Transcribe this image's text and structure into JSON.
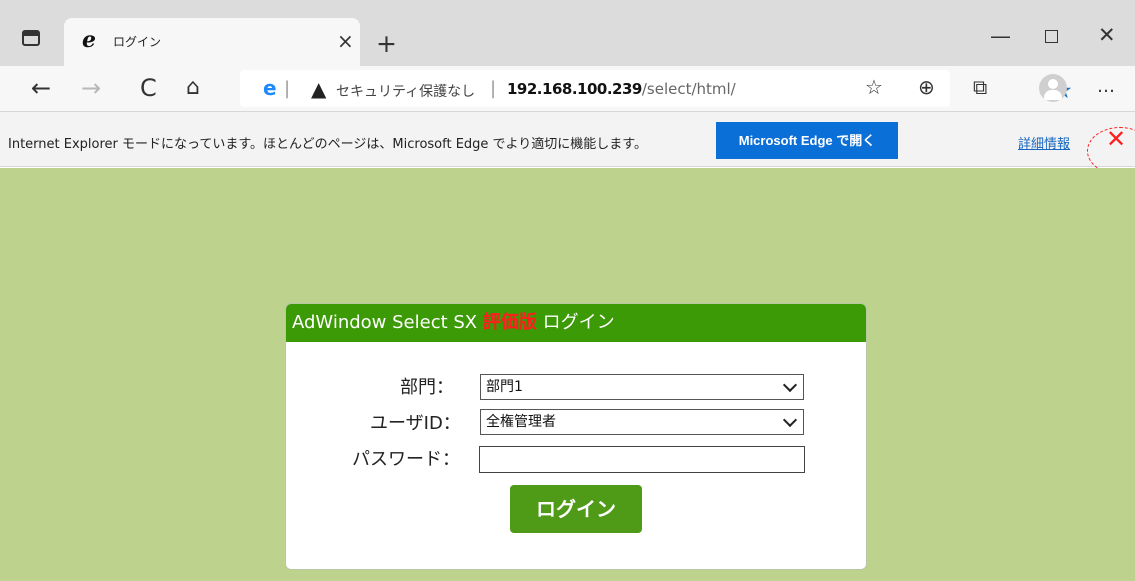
{
  "browser": {
    "tab_title": "ログイン",
    "new_tab": "+",
    "window": {
      "minimize": "—",
      "maximize": "□",
      "close": "✕"
    },
    "nav": {
      "back": "←",
      "forward": "→",
      "refresh": "C",
      "home": "⌂"
    },
    "address": {
      "security": "セキュリティ保護なし",
      "host": "192.168.100.239",
      "path": "/select/html/"
    },
    "toolbar_icons": [
      "star-icon",
      "favorites-icon",
      "collections-icon",
      "extension-icon",
      "profile-icon",
      "more-icon"
    ],
    "colors": {
      "tab_strip": "#dcdcdc",
      "star": "#1672c8",
      "notice": "#f3f3f3"
    }
  },
  "notice": {
    "text": "Internet Explorer モードになっています。ほとんどのページは、Microsoft Edge でより適切に機能します。",
    "open_button": "Microsoft Edge で開く",
    "details_link": "詳細情報",
    "close": "✕"
  },
  "login": {
    "title": "AdWindow Select SX ",
    "evaluation": "評価版",
    "suffix": "  ログイン",
    "department_label": "部門：",
    "department_value": "部門1",
    "user_label": "ユーザID：",
    "user_value": "全権管理者",
    "password_label": "パスワード：",
    "password_value": "",
    "submit": "ログイン"
  },
  "annotation": {
    "color": "#ff1e1e"
  }
}
